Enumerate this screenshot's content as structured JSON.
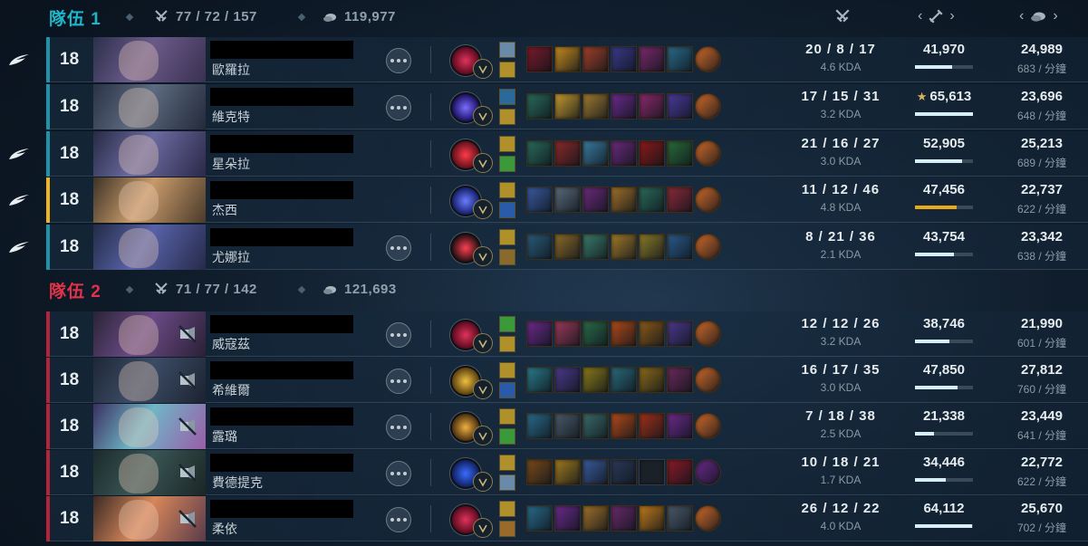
{
  "team1": {
    "name": "隊伍 1",
    "kda": "77 / 72 / 157",
    "gold": "119,977"
  },
  "team2": {
    "name": "隊伍 2",
    "kda": "71 / 77 / 142",
    "gold": "121,693"
  },
  "column_icons": [
    "crossed-swords-icon",
    "sword-icon",
    "gold-coin-icon"
  ],
  "team1_players": [
    {
      "level": "18",
      "champion": "歐羅拉",
      "kda": "20 / 8 / 17",
      "kda_ratio": "4.6 KDA",
      "damage": "41,970",
      "damage_fraction": 0.64,
      "gold": "24,989",
      "gpm": "683 / 分鐘",
      "top_damage": false,
      "me": false,
      "has_side_icon": true
    },
    {
      "level": "18",
      "champion": "維克特",
      "kda": "17 / 15 / 31",
      "kda_ratio": "3.2 KDA",
      "damage": "65,613",
      "damage_fraction": 1.0,
      "gold": "23,696",
      "gpm": "648 / 分鐘",
      "top_damage": true,
      "me": false,
      "has_side_icon": false
    },
    {
      "level": "18",
      "champion": "星朵拉",
      "kda": "21 / 16 / 27",
      "kda_ratio": "3.0 KDA",
      "damage": "52,905",
      "damage_fraction": 0.81,
      "gold": "25,213",
      "gpm": "689 / 分鐘",
      "top_damage": false,
      "me": false,
      "has_side_icon": true
    },
    {
      "level": "18",
      "champion": "杰西",
      "kda": "11 / 12 / 46",
      "kda_ratio": "4.8 KDA",
      "damage": "47,456",
      "damage_fraction": 0.72,
      "gold": "22,737",
      "gpm": "622 / 分鐘",
      "top_damage": false,
      "me": true,
      "has_side_icon": true
    },
    {
      "level": "18",
      "champion": "尤娜拉",
      "kda": "8 / 21 / 36",
      "kda_ratio": "2.1 KDA",
      "damage": "43,754",
      "damage_fraction": 0.67,
      "gold": "23,342",
      "gpm": "638 / 分鐘",
      "top_damage": false,
      "me": false,
      "has_side_icon": true
    }
  ],
  "team2_players": [
    {
      "level": "18",
      "champion": "威寇茲",
      "kda": "12 / 12 / 26",
      "kda_ratio": "3.2 KDA",
      "damage": "38,746",
      "damage_fraction": 0.59,
      "gold": "21,990",
      "gpm": "601 / 分鐘"
    },
    {
      "level": "18",
      "champion": "希維爾",
      "kda": "16 / 17 / 35",
      "kda_ratio": "3.0 KDA",
      "damage": "47,850",
      "damage_fraction": 0.73,
      "gold": "27,812",
      "gpm": "760 / 分鐘"
    },
    {
      "level": "18",
      "champion": "露璐",
      "kda": "7 / 18 / 38",
      "kda_ratio": "2.5 KDA",
      "damage": "21,338",
      "damage_fraction": 0.33,
      "gold": "23,449",
      "gpm": "641 / 分鐘"
    },
    {
      "level": "18",
      "champion": "費德提克",
      "kda": "10 / 18 / 21",
      "kda_ratio": "1.7 KDA",
      "damage": "34,446",
      "damage_fraction": 0.53,
      "gold": "22,772",
      "gpm": "622 / 分鐘"
    },
    {
      "level": "18",
      "champion": "柔依",
      "kda": "26 / 12 / 22",
      "kda_ratio": "4.0 KDA",
      "damage": "64,112",
      "damage_fraction": 0.98,
      "gold": "25,670",
      "gpm": "702 / 分鐘"
    }
  ],
  "star_glyph": "★",
  "arrow_left": "‹",
  "arrow_right": "›"
}
